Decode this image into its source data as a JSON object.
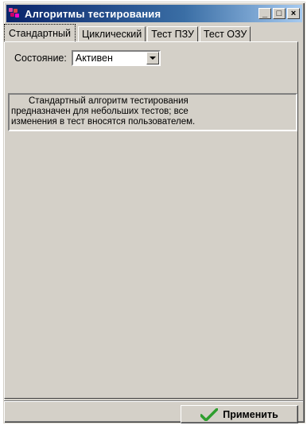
{
  "window": {
    "title": "Алгоритмы тестирования",
    "buttons": {
      "minimize": "_",
      "maximize": "□",
      "close": "×"
    }
  },
  "tabs": [
    {
      "label": "Стандартный",
      "active": true
    },
    {
      "label": "Циклический",
      "active": false
    },
    {
      "label": "Тест ПЗУ",
      "active": false
    },
    {
      "label": "Тест ОЗУ",
      "active": false
    }
  ],
  "state": {
    "label": "Состояние:",
    "value": "Активен"
  },
  "description": {
    "line1": "Стандартный алгоритм тестирования",
    "line2": "предназначен для небольших тестов; все",
    "line3": "изменения в тест вносятся пользователем."
  },
  "apply_button": {
    "label": "Применить",
    "icon": "check-icon"
  },
  "colors": {
    "face": "#d4d0c8",
    "title_start": "#0a246a",
    "check": "#2e9e2e"
  }
}
